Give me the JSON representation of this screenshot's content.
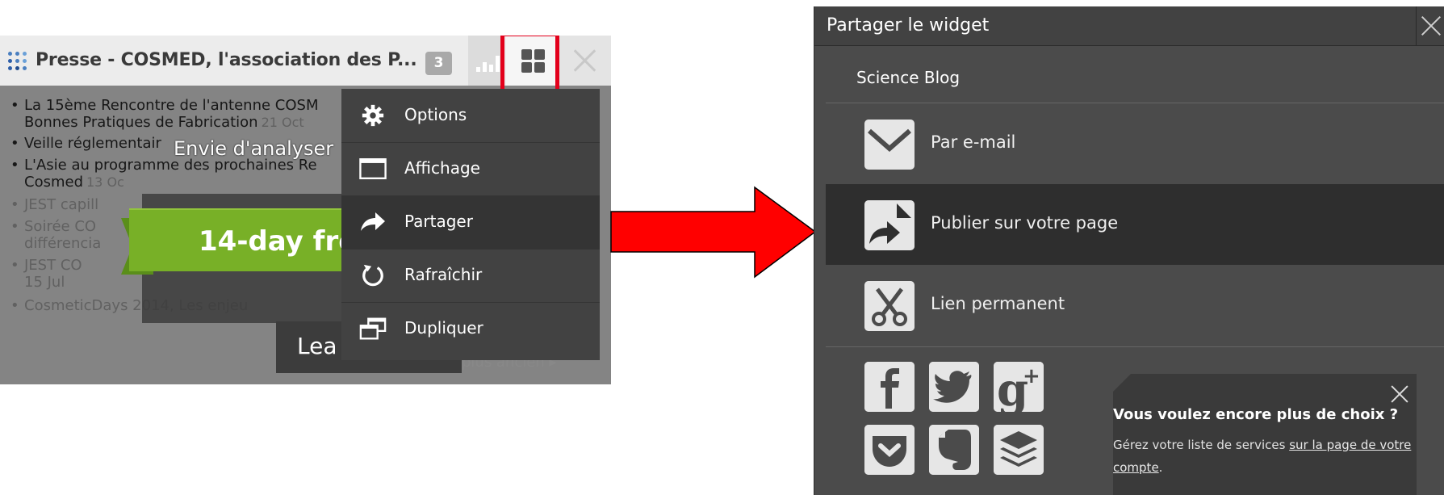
{
  "widget": {
    "title": "Presse - COSMED, l'association des P...",
    "count_badge": "3",
    "news": [
      {
        "title": "La 15ème Rencontre de l'antenne COSM",
        "title2": "Bonnes Pratiques de Fabrication",
        "date": "21 Oct"
      },
      {
        "title": "Veille réglementair",
        "date": ""
      },
      {
        "title": "L'Asie au programme des prochaines Re",
        "title2": "Cosmed",
        "date": "13 Oc"
      },
      {
        "title": "JEST capill",
        "date": ""
      },
      {
        "title": "Soirée CO",
        "title2": "différencia",
        "date": ""
      },
      {
        "title": "JEST CO",
        "title2": "15 Jul",
        "date": ""
      },
      {
        "title": "CosmeticDays 2014, Les enjeu",
        "date": ""
      }
    ],
    "older_link": "plus ancien ▸"
  },
  "promo": {
    "heading": "Envie d'analyser",
    "trial_text": "14-day free",
    "learn_text": "Lea"
  },
  "menu": {
    "items": [
      {
        "label": "Options",
        "icon": "gear-icon"
      },
      {
        "label": "Affichage",
        "icon": "window-icon"
      },
      {
        "label": "Partager",
        "icon": "share-arrow-icon"
      },
      {
        "label": "Rafraîchir",
        "icon": "refresh-icon"
      },
      {
        "label": "Dupliquer",
        "icon": "duplicate-icon"
      }
    ],
    "active_index": 2
  },
  "share": {
    "title": "Partager le widget",
    "site_name": "Science Blog",
    "options": [
      {
        "label": "Par e-mail",
        "icon": "envelope-icon"
      },
      {
        "label": "Publier sur votre page",
        "icon": "publish-page-icon"
      },
      {
        "label": "Lien permanent",
        "icon": "scissors-icon"
      }
    ],
    "social": [
      {
        "name": "facebook-icon",
        "glyph": "f"
      },
      {
        "name": "twitter-icon",
        "glyph": "t"
      },
      {
        "name": "google-plus-icon",
        "glyph": "g+"
      },
      {
        "name": "pocket-icon",
        "glyph": "⌄"
      },
      {
        "name": "evernote-icon",
        "glyph": "e"
      },
      {
        "name": "buffer-icon",
        "glyph": "≡"
      }
    ],
    "more": {
      "title": "Vous voulez encore plus de choix ?",
      "text_before": "Gérez votre liste de services ",
      "link_text": "sur la page de votre compte",
      "text_after": "."
    }
  },
  "colors": {
    "highlight": "#e3001b",
    "arrow": "#ff0000",
    "trial_green": "#78b027"
  }
}
